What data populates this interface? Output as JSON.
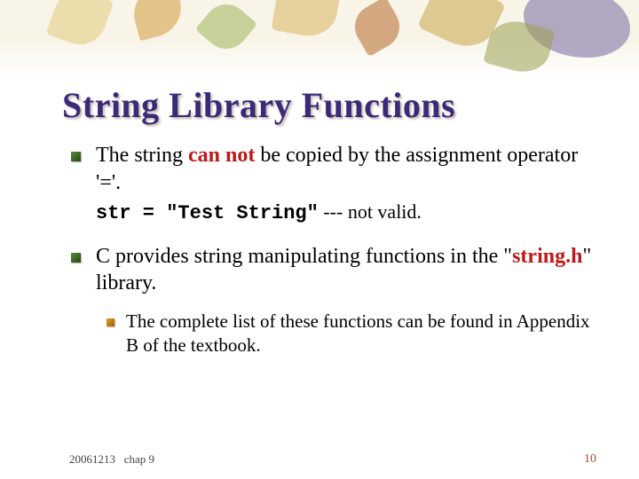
{
  "title": "String Library Functions",
  "bullet1": {
    "pre": "The string ",
    "em": "can not",
    "post": " be copied by the assignment operator '='.",
    "code": "str = \"Test String\"",
    "codeTail": " --- not valid."
  },
  "bullet2": {
    "pre": "C provides string manipulating functions in the \"",
    "em": "string.h",
    "post": "\" library.",
    "sub": "The complete list of these functions can be found in Appendix B of the textbook."
  },
  "footer": {
    "date": "20061213",
    "chapter": "chap 9",
    "page": "10"
  }
}
